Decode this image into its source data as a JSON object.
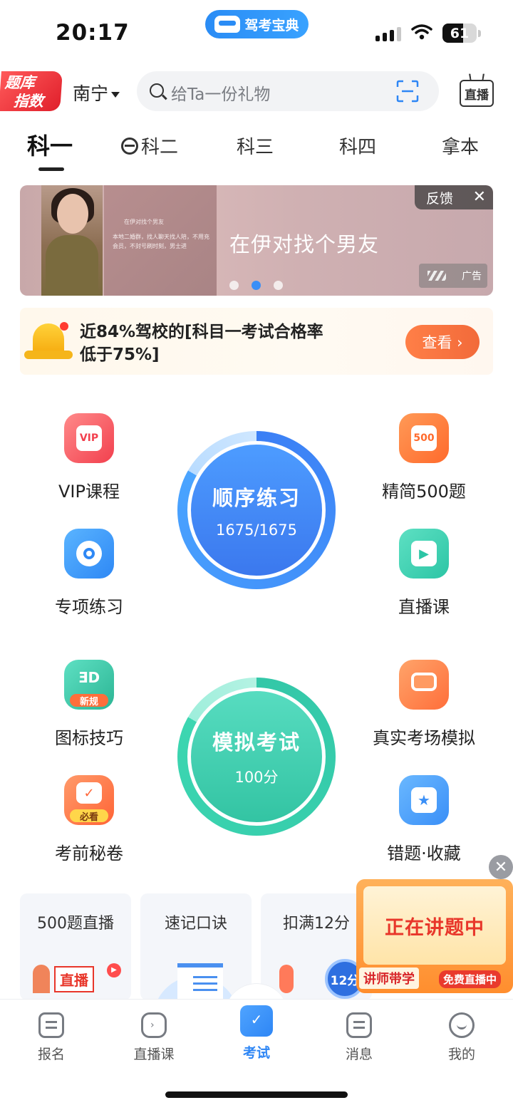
{
  "status_bar": {
    "time": "20:17",
    "app_name": "驾考宝典",
    "battery": "61",
    "battery_level": 0.61
  },
  "header": {
    "badge_line1": "题库",
    "badge_line2": "指数",
    "city": "南宁",
    "search_placeholder": "给Ta一份礼物",
    "live_label": "直播"
  },
  "tabs": [
    {
      "label": "科一",
      "active": true
    },
    {
      "label": "科二",
      "active": false
    },
    {
      "label": "科三",
      "active": false
    },
    {
      "label": "科四",
      "active": false
    },
    {
      "label": "拿本",
      "active": false
    }
  ],
  "banner": {
    "headline": "在伊对找个男友",
    "mini_title": "在伊对找个男友",
    "mini_text": "本地二婚群，找人聊天找人陪，不用充会员，不封号刷时刻，男士进",
    "feedback": "反馈",
    "close": "✕",
    "ad_label": "广告",
    "dots": 3,
    "active_dot": 1
  },
  "notice": {
    "line1": "近84%驾校的[科目一考试合格率",
    "line2": "低于75%]",
    "button": "查看 ›"
  },
  "features": {
    "vip": "VIP课程",
    "vip_icon_text": "VIP",
    "jingjian": "精简500题",
    "jingjian_icon_text": "500",
    "zhuanxiang": "专项练习",
    "zhibo": "直播课",
    "tubiao": "图标技巧",
    "tubiao_tag": "新规",
    "zhenshi": "真实考场模拟",
    "miquan": "考前秘卷",
    "miquan_tag": "必看",
    "cuoti": "错题·收藏"
  },
  "practice": {
    "title": "顺序练习",
    "progress": "1675/1675",
    "done": 1675,
    "total": 1675
  },
  "exam": {
    "title": "模拟考试",
    "score": "100分"
  },
  "bottom_cards": [
    {
      "title": "500题直播",
      "art_text": "直播"
    },
    {
      "title": "速记口诀",
      "art_text": ""
    },
    {
      "title": "扣满12分",
      "art_text": "12分"
    }
  ],
  "float_live": {
    "title": "正在讲题中",
    "badge1": "讲师带学",
    "badge2": "免费直播中",
    "close": "✕"
  },
  "nav": [
    {
      "label": "报名",
      "active": false
    },
    {
      "label": "直播课",
      "active": false
    },
    {
      "label": "考试",
      "active": true
    },
    {
      "label": "消息",
      "active": false
    },
    {
      "label": "我的",
      "active": false
    }
  ],
  "colors": {
    "accent": "#2e86f5",
    "practice_ring": "#3b7ff5",
    "exam_ring": "#33c7a8",
    "notice_button": "#f26a3a"
  }
}
